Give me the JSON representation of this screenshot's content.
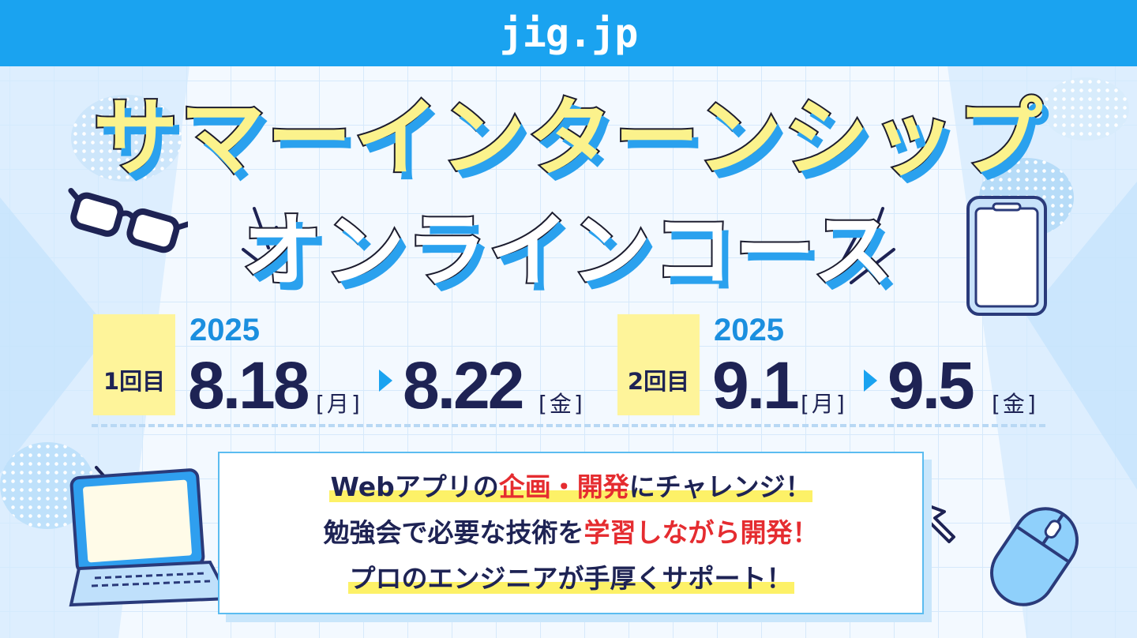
{
  "header": {
    "logo_text": "jig.jp"
  },
  "title": {
    "line1": "サマーインターンシップ",
    "line2": "オンラインコース"
  },
  "sessions": [
    {
      "badge": "1回目",
      "year": "2025",
      "start_date": "8.18",
      "start_dow": "[月]",
      "end_date": "8.22",
      "end_dow": "[金]"
    },
    {
      "badge": "2回目",
      "year": "2025",
      "start_date": "9.1",
      "start_dow": "[月]",
      "end_date": "9.5",
      "end_dow": "[金]"
    }
  ],
  "info": {
    "line1": {
      "pre": "Webアプリの",
      "highlight": "企画・開発",
      "post": "にチャレンジ！"
    },
    "line2": {
      "pre": "勉強会で必要な技術を",
      "highlight": "学習しながら開発！",
      "post": ""
    },
    "line3": {
      "pre": "プロのエンジニアが手厚くサポート！"
    }
  },
  "icons": [
    "glasses-icon",
    "smartphone-icon",
    "laptop-icon",
    "cursor-icon",
    "mouse-icon"
  ],
  "colors": {
    "accent_blue": "#1aa3f0",
    "title_yellow": "#fbf28c",
    "navy": "#1e2354",
    "highlight_red": "#e52c30",
    "badge_yellow": "#fef49a"
  }
}
